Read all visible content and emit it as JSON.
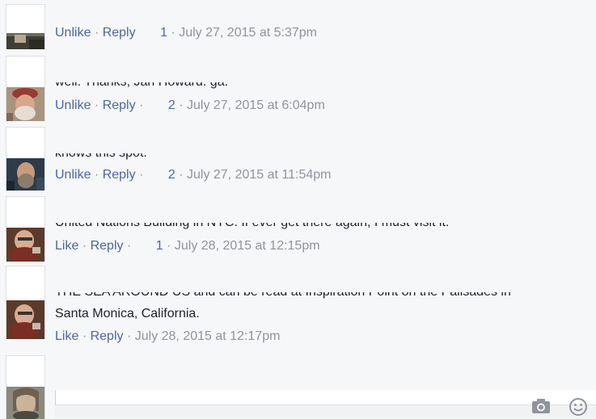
{
  "comments": [
    {
      "clipped_text": "",
      "like_label": "Unlike",
      "reply_label": "Reply",
      "sep": "·",
      "likes": "1",
      "timestamp": "July 27, 2015 at 5:37pm"
    },
    {
      "clipped_text": "well. Thanks, Jan Howard. ga.",
      "like_label": "Unlike",
      "reply_label": "Reply",
      "sep": "·",
      "likes": "2",
      "timestamp": "July 27, 2015 at 6:04pm"
    },
    {
      "clipped_text": "knows this spot.",
      "like_label": "Unlike",
      "reply_label": "Reply",
      "sep": "·",
      "likes": "2",
      "timestamp": "July 27, 2015 at 11:54pm"
    },
    {
      "clipped_text": "United Nations Building in NYC. If ever get there again, I must visit it.",
      "like_label": "Like",
      "reply_label": "Reply",
      "sep": "·",
      "likes": "1",
      "timestamp": "July 28, 2015 at 12:15pm"
    },
    {
      "clipped_text": "THE SEA AROUND US and can be read at Inspiration Point on the Palisades in",
      "body_text": "Santa Monica, California.",
      "like_label": "Like",
      "reply_label": "Reply",
      "sep": "·",
      "timestamp": "July 28, 2015 at 12:17pm"
    }
  ],
  "composer": {
    "camera_icon": "camera-icon",
    "emoji_icon": "smiley-icon"
  }
}
